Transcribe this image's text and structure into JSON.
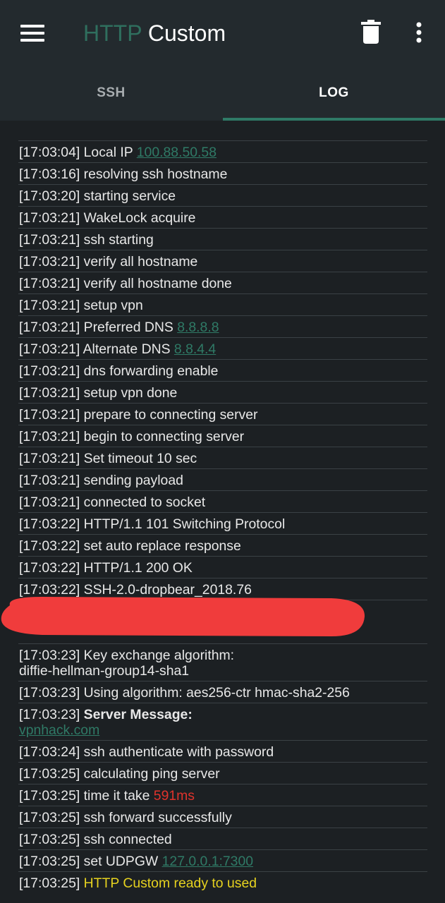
{
  "appbar": {
    "brand": "HTTP",
    "title_rest": " Custom",
    "icons": {
      "menu": "hamburger-menu-icon",
      "delete": "trash-icon",
      "more": "more-vertical-icon"
    }
  },
  "tabs": [
    {
      "label": "SSH",
      "selected": false
    },
    {
      "label": "LOG",
      "selected": true
    }
  ],
  "colors": {
    "accent": "#2f7a66",
    "error": "#e0332c",
    "success": "#e6d21f",
    "redaction": "#f03c3c"
  },
  "log": [
    {
      "time": "[17:03:04]",
      "text": " Local IP ",
      "value": "100.88.50.58"
    },
    {
      "time": "[17:03:16]",
      "text": " resolving ssh hostname"
    },
    {
      "time": "[17:03:20]",
      "text": " starting service"
    },
    {
      "time": "[17:03:21]",
      "text": " WakeLock acquire"
    },
    {
      "time": "[17:03:21]",
      "text": " ssh starting"
    },
    {
      "time": "[17:03:21]",
      "text": " verify all hostname"
    },
    {
      "time": "[17:03:21]",
      "text": " verify all hostname done"
    },
    {
      "time": "[17:03:21]",
      "text": " setup vpn"
    },
    {
      "time": "[17:03:21]",
      "text": " Preferred DNS ",
      "value": "8.8.8.8"
    },
    {
      "time": "[17:03:21]",
      "text": " Alternate DNS ",
      "value": "8.8.4.4"
    },
    {
      "time": "[17:03:21]",
      "text": " dns forwarding enable"
    },
    {
      "time": "[17:03:21]",
      "text": " setup vpn done"
    },
    {
      "time": "[17:03:21]",
      "text": " prepare to connecting server"
    },
    {
      "time": "[17:03:21]",
      "text": " begin to connecting server"
    },
    {
      "time": "[17:03:21]",
      "text": " Set timeout 10 sec"
    },
    {
      "time": "[17:03:21]",
      "text": " sending payload"
    },
    {
      "time": "[17:03:21]",
      "text": " connected to socket"
    },
    {
      "time": "[17:03:22]",
      "text": " HTTP/1.1 101 Switching Protocol"
    },
    {
      "time": "[17:03:22]",
      "text": " set auto replace response"
    },
    {
      "time": "[17:03:22]",
      "text": " HTTP/1.1 200 OK"
    },
    {
      "time": "[17:03:22]",
      "text": " SSH-2.0-dropbear_2018.76"
    },
    {
      "time": "[17:03:23]",
      "text": " Key exchange algorithm:",
      "line2": "diffie-hellman-group14-sha1"
    },
    {
      "time": "[17:03:23]",
      "text": " Using algorithm: aes256-ctr hmac-sha2-256"
    },
    {
      "time": "[17:03:23]",
      "text": " Server Message:",
      "line2": "vpnhack.com"
    },
    {
      "time": "[17:03:24]",
      "text": " ssh authenticate with password"
    },
    {
      "time": "[17:03:25]",
      "text": " calculating ping server"
    },
    {
      "time": "[17:03:25]",
      "text": " time it take ",
      "value": "591ms"
    },
    {
      "time": "[17:03:25]",
      "text": " ssh forward successfully"
    },
    {
      "time": "[17:03:25]",
      "text": " ssh connected"
    },
    {
      "time": "[17:03:25]",
      "text": " set UDPGW ",
      "value": "127.0.0.1:7300"
    },
    {
      "time": "[17:03:25]",
      "text": " HTTP Custom ready to used"
    }
  ]
}
